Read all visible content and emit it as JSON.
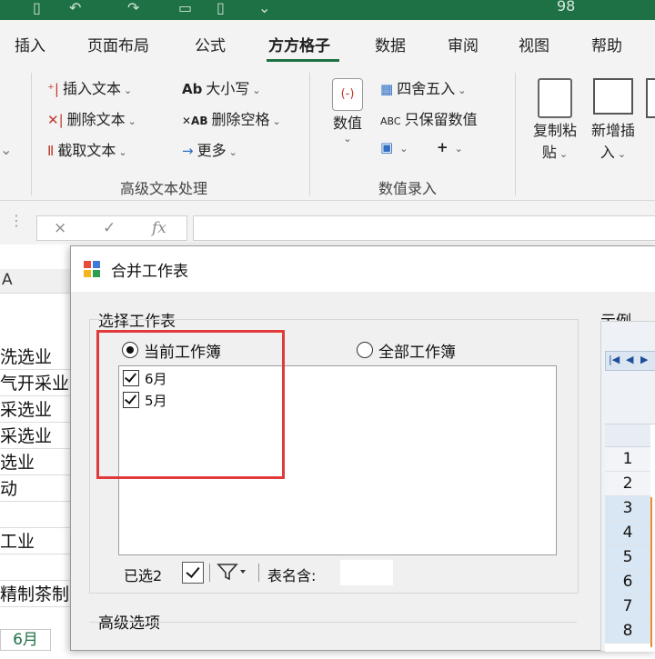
{
  "titlebar": {
    "number": "98"
  },
  "tabs": [
    {
      "label": "插入",
      "active": false
    },
    {
      "label": "页面布局",
      "active": false
    },
    {
      "label": "公式",
      "active": false
    },
    {
      "label": "方方格子",
      "active": true
    },
    {
      "label": "数据",
      "active": false
    },
    {
      "label": "审阅",
      "active": false
    },
    {
      "label": "视图",
      "active": false
    },
    {
      "label": "帮助",
      "active": false
    }
  ],
  "ribbon": {
    "text_group": {
      "insert_text": "插入文本",
      "delete_text": "删除文本",
      "extract_text": "截取文本",
      "case": "大小写",
      "delete_space": "删除空格",
      "more": "更多",
      "group_label": "高级文本处理"
    },
    "number_group": {
      "numeric": "数值",
      "round": "四舍五入",
      "keep_numbers": "只保留数值",
      "group_label": "数值录入"
    },
    "paste_group": {
      "copy_paste_line1": "复制粘",
      "copy_paste_line2": "贴",
      "new_insert_line1": "新增插",
      "new_insert_line2": "入"
    }
  },
  "formula_bar": {
    "cancel": "×",
    "confirm": "✓",
    "fx": "fx"
  },
  "sheet": {
    "column_header": "A",
    "cells": [
      "洗选业",
      "气开采业",
      "采选业",
      "采选业",
      "选业",
      "动",
      "",
      "工业",
      "",
      "精制茶制"
    ],
    "tab_label": "6月"
  },
  "dialog": {
    "title": "合并工作表",
    "group_label": "选择工作表",
    "radio_current": "当前工作簿",
    "radio_all": "全部工作簿",
    "sheets": [
      {
        "name": "6月",
        "checked": true
      },
      {
        "name": "5月",
        "checked": true
      }
    ],
    "selected_count": "已选2",
    "sheet_name_label": "表名含:",
    "sheet_name_value": "",
    "advanced_label": "高级选项",
    "example_label": "示例",
    "example_rows": [
      "1",
      "2",
      "3",
      "4",
      "5",
      "6",
      "7",
      "8"
    ]
  }
}
